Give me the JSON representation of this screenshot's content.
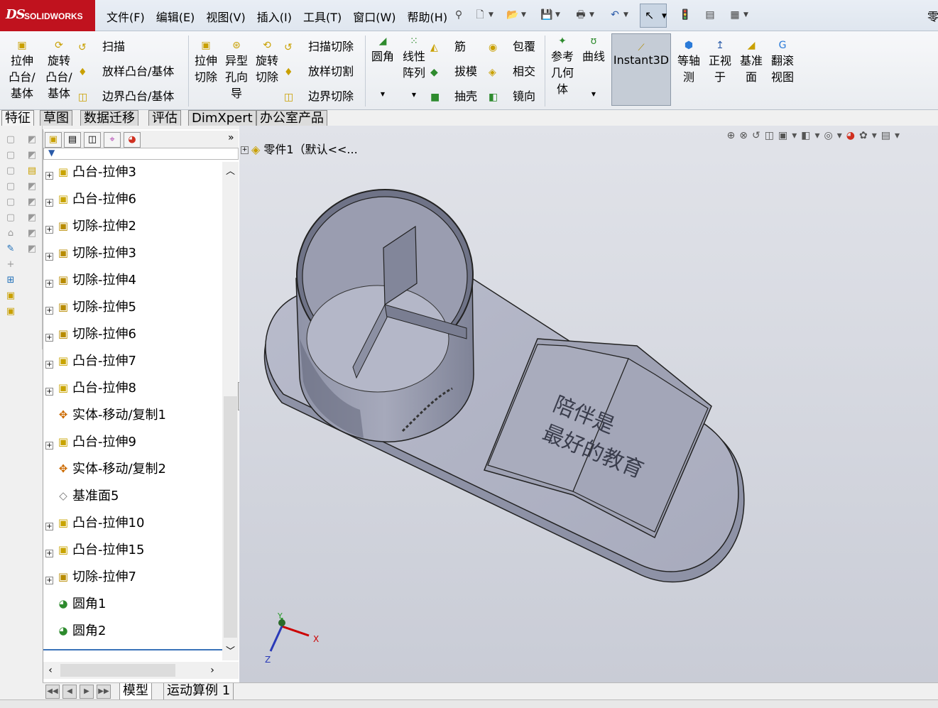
{
  "app": {
    "logo_ds": "DS",
    "logo_text": "SOLIDWORKS",
    "title_fragment": "零"
  },
  "menu": [
    "文件(F)",
    "编辑(E)",
    "视图(V)",
    "插入(I)",
    "工具(T)",
    "窗口(W)",
    "帮助(H)"
  ],
  "ribbon": {
    "extrude_boss": [
      "拉伸",
      "凸台/",
      "基体"
    ],
    "revolve_boss": [
      "旋转",
      "凸台/",
      "基体"
    ],
    "sweep": "扫描",
    "loft_boss": "放样凸台/基体",
    "boundary_boss": "边界凸台/基体",
    "extrude_cut": [
      "拉伸",
      "切除"
    ],
    "hole_wizard": [
      "异型",
      "孔向",
      "导"
    ],
    "revolve_cut": [
      "旋转",
      "切除"
    ],
    "swept_cut": "扫描切除",
    "lofted_cut": "放样切割",
    "boundary_cut": "边界切除",
    "fillet": "圆角",
    "linear_pattern": [
      "线性",
      "阵列"
    ],
    "rib": "筋",
    "draft": "拔模",
    "shell": "抽壳",
    "wrap": "包覆",
    "intersect": "相交",
    "mirror": "镜向",
    "ref_geometry": [
      "参考",
      "几何",
      "体"
    ],
    "curves": "曲线",
    "instant3d": "Instant3D",
    "isometric": [
      "等轴",
      "测"
    ],
    "normal_to": [
      "正视",
      "于"
    ],
    "datum_plane": [
      "基准",
      "面"
    ],
    "scroll_view": [
      "翻滚",
      "视图"
    ]
  },
  "command_tabs": [
    "特征",
    "草图",
    "数据迁移",
    "评估",
    "DimXpert",
    "办公室产品"
  ],
  "feature_tree": {
    "nodes": [
      {
        "label": "凸台-拉伸3",
        "type": "boss",
        "expandable": true
      },
      {
        "label": "凸台-拉伸6",
        "type": "boss",
        "expandable": true
      },
      {
        "label": "切除-拉伸2",
        "type": "cut",
        "expandable": true
      },
      {
        "label": "切除-拉伸3",
        "type": "cut",
        "expandable": true
      },
      {
        "label": "切除-拉伸4",
        "type": "cut",
        "expandable": true
      },
      {
        "label": "切除-拉伸5",
        "type": "cut",
        "expandable": true
      },
      {
        "label": "切除-拉伸6",
        "type": "cut",
        "expandable": true
      },
      {
        "label": "凸台-拉伸7",
        "type": "boss",
        "expandable": true
      },
      {
        "label": "凸台-拉伸8",
        "type": "boss",
        "expandable": true
      },
      {
        "label": "实体-移动/复制1",
        "type": "move",
        "expandable": false
      },
      {
        "label": "凸台-拉伸9",
        "type": "boss",
        "expandable": true
      },
      {
        "label": "实体-移动/复制2",
        "type": "move",
        "expandable": false
      },
      {
        "label": "基准面5",
        "type": "plane",
        "expandable": false
      },
      {
        "label": "凸台-拉伸10",
        "type": "boss",
        "expandable": true
      },
      {
        "label": "凸台-拉伸15",
        "type": "boss",
        "expandable": true
      },
      {
        "label": "切除-拉伸7",
        "type": "cut",
        "expandable": true
      },
      {
        "label": "圆角1",
        "type": "fillet",
        "expandable": false
      },
      {
        "label": "圆角2",
        "type": "fillet",
        "expandable": false
      }
    ]
  },
  "viewport": {
    "part_label": "零件1（默认<<...",
    "book_text_line1": "陪伴是",
    "book_text_line2": "最好的教育",
    "triad": {
      "x": "X",
      "y": "Y",
      "z": "Z"
    }
  },
  "bottom_tabs": [
    "模型",
    "运动算例 1"
  ]
}
